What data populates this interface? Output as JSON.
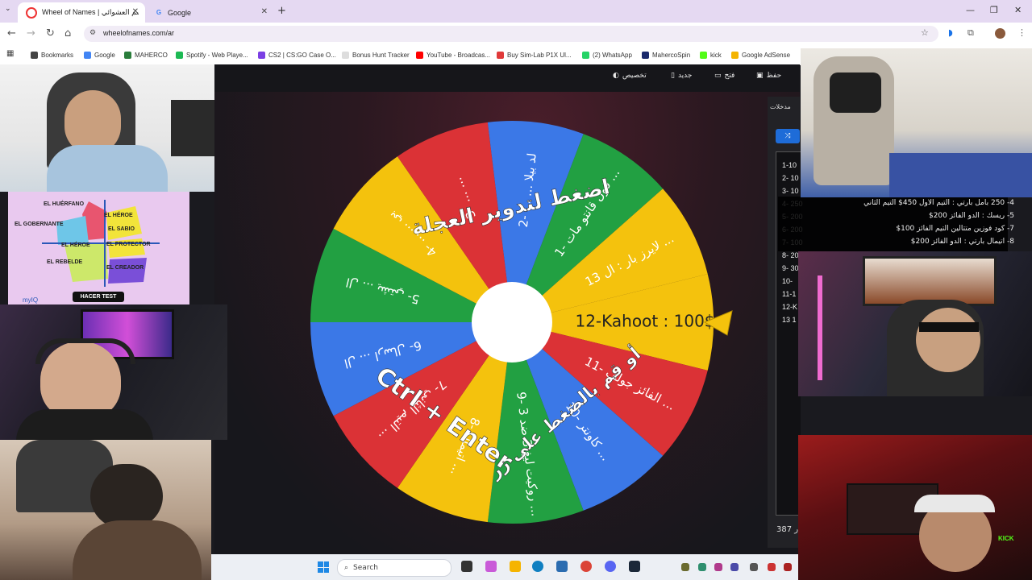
{
  "browser": {
    "tabs": [
      {
        "title": "Wheel of Names | اسم العشوائي",
        "active": true
      },
      {
        "title": "Google",
        "active": false
      }
    ],
    "url": "wheelofnames.com/ar",
    "bookmarks": [
      "Bookmarks",
      "Google",
      "MAHERCO",
      "Spotify - Web Playe...",
      "CS2 | CS:GO Case O...",
      "Bonus Hunt Tracker",
      "YouTube - Broadcas...",
      "Buy Sim-Lab P1X Ul...",
      "(2) WhatsApp",
      "MahercoSpin",
      "kick",
      "Google AdSense"
    ],
    "bookmark_colors": [
      "#444444",
      "#4285f4",
      "#2a7d3b",
      "#1db954",
      "#7b3fe4",
      "#dddddd",
      "#ff0000",
      "#e03a3a",
      "#25d366",
      "#1a2a6c",
      "#53fc18",
      "#f4b400"
    ]
  },
  "app": {
    "toolbar": {
      "customize": "تخصيص",
      "new": "جديد",
      "open": "فتح",
      "save": "حفظ"
    },
    "wheel": {
      "center_text_top": "اضغط لتدوير العجلة",
      "center_text_bottom": "أو قم بالضغط على زر",
      "shortcut": "Ctrl + Enter",
      "segments": [
        {
          "label": "12-Kahoot : 100$",
          "color": "#f4c20d"
        },
        {
          "label": "11- الفائز جولف ...",
          "color": "#db3236"
        },
        {
          "label": "10- كاونتر ...",
          "color": "#3b78e7"
        },
        {
          "label": "9- روكيت ليغ 3 ضد 3 ...",
          "color": "#22a042"
        },
        {
          "label": "8- اتيمال ...",
          "color": "#f4c20d"
        },
        {
          "label": "7- التيم الثاني ...",
          "color": "#db3236"
        },
        {
          "label": "6- ال ... ارسال",
          "color": "#3b78e7"
        },
        {
          "label": "5- ال ... يشتي",
          "color": "#22a042"
        },
        {
          "label": "4- ... ... بي",
          "color": "#f4c20d"
        },
        {
          "label": "3- ... ...",
          "color": "#db3236"
        },
        {
          "label": "2- ... ... لد بيلا",
          "color": "#3b78e7"
        },
        {
          "label": "1- قول قانتو مات ...",
          "color": "#22a042"
        },
        {
          "label": "13 لايرز بار : ال ...",
          "color": "#f4c20d"
        }
      ]
    },
    "sidebar": {
      "tab_label": "مدخلات",
      "shuffle_label": "⤨",
      "entries": [
        "1-10",
        "2- 10",
        "3- 10",
        "4- 250",
        "5- 200",
        "6- 200",
        "7- 100",
        "8- 200",
        "9- 30",
        "10-",
        "11-1",
        "12-K",
        "13 1"
      ],
      "count": "387 ر"
    },
    "overlay_entries": [
      "4- 250 بامل بارتي : التيم الاول 450$ التيم الثاني",
      "5- ريسك : الدو الفائز 200$",
      "7- كود فوزين متتالين التيم الفائز 100$",
      "8- اتيمال بارتي : الدو الفائز 200$"
    ]
  },
  "webcams": {
    "quiz": {
      "archetypes": [
        "EL HUÉRFANO",
        "EL GOBERNANTE",
        "EL HÉROE",
        "EL SABIO",
        "EL HÉROE",
        "EL PROTECTOR",
        "EL REBELDE",
        "EL CREADOR"
      ],
      "button": "HACER TEST",
      "brand": "myIQ"
    },
    "overlay_label": "KICK"
  },
  "taskbar": {
    "search_placeholder": "Search"
  },
  "icons": [
    "search-icon",
    "bookmark-star-icon",
    "tab-close-icon",
    "back-arrow-icon",
    "reload-icon",
    "home-icon",
    "shuffle-icon",
    "windows-start-icon",
    "wheel-pointer-icon"
  ]
}
